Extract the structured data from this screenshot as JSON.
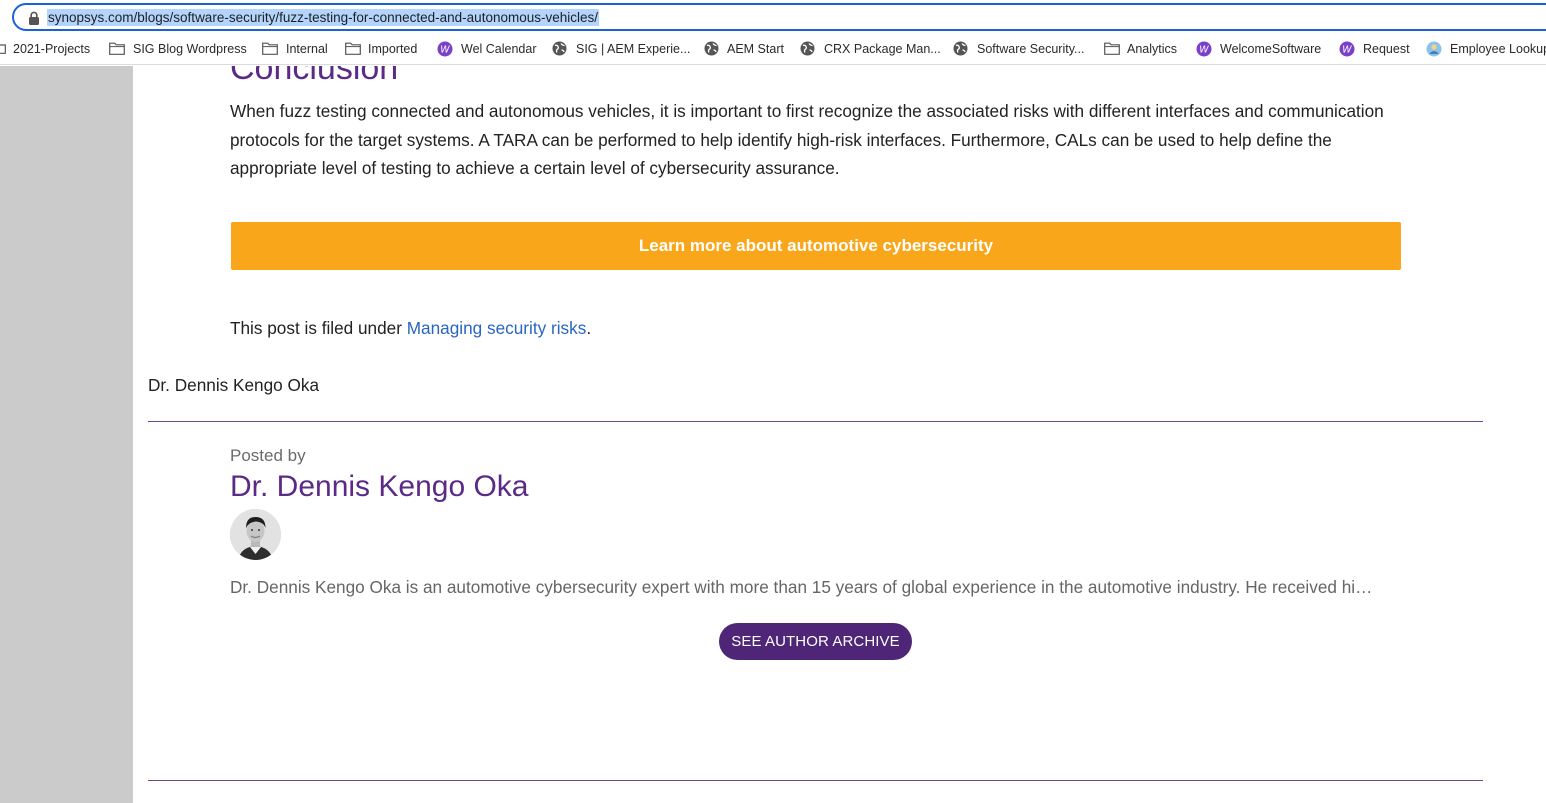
{
  "browser": {
    "url": "synopsys.com/blogs/software-security/fuzz-testing-for-connected-and-autonomous-vehicles/",
    "bookmarks": [
      {
        "label": "2021-Projects",
        "icon": "folder-icon"
      },
      {
        "label": "SIG Blog Wordpress",
        "icon": "folder-icon"
      },
      {
        "label": "Internal",
        "icon": "folder-icon"
      },
      {
        "label": "Imported",
        "icon": "folder-icon"
      },
      {
        "label": "Wel Calendar",
        "icon": "w-logo-icon"
      },
      {
        "label": "SIG | AEM Experie...",
        "icon": "globe-icon"
      },
      {
        "label": "AEM Start",
        "icon": "globe-icon"
      },
      {
        "label": "CRX Package Man...",
        "icon": "globe-icon"
      },
      {
        "label": "Software Security...",
        "icon": "globe-icon"
      },
      {
        "label": "Analytics",
        "icon": "folder-icon"
      },
      {
        "label": "WelcomeSoftware",
        "icon": "w-logo-icon"
      },
      {
        "label": "Request",
        "icon": "w-logo-icon"
      },
      {
        "label": "Employee Lookup",
        "icon": "person-icon"
      }
    ]
  },
  "article": {
    "section_heading": "Conclusion",
    "conclusion_text": "When fuzz testing connected and autonomous vehicles, it is important to first recognize the associated risks with different interfaces and communication protocols for the target systems. A TARA can be performed to help identify high-risk interfaces. Furthermore, CALs can be used to help define the appropriate level of testing to achieve a certain level of cybersecurity assurance.",
    "cta_label": "Learn more about automotive cybersecurity",
    "filed_prefix": "This post is filed under ",
    "filed_link": "Managing security risks",
    "filed_suffix": "."
  },
  "author": {
    "name_plain": "Dr. Dennis Kengo Oka",
    "posted_by": "Posted by",
    "name": "Dr. Dennis Kengo Oka",
    "bio": "Dr. Dennis Kengo Oka is an automotive cybersecurity expert with more than 15 years of global experience in the automotive industry. He received hi…",
    "archive_button": "SEE AUTHOR ARCHIVE"
  },
  "colors": {
    "accent_purple": "#5b2a86",
    "button_purple": "#4e2577",
    "cta_orange": "#faa61a",
    "link_blue": "#2766c1",
    "url_highlight": "#b3d4fd"
  }
}
